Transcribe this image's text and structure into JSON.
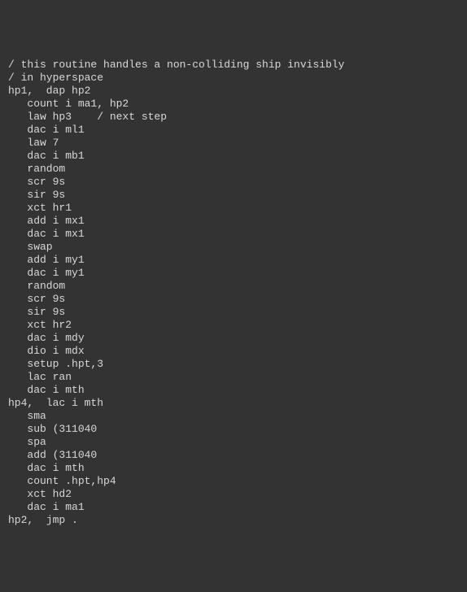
{
  "code": {
    "lines": [
      "/ this routine handles a non-colliding ship invisibly",
      "/ in hyperspace",
      "",
      "hp1,  dap hp2",
      "   count i ma1, hp2",
      "   law hp3    / next step",
      "   dac i ml1",
      "   law 7",
      "   dac i mb1",
      "   random",
      "   scr 9s",
      "   sir 9s",
      "   xct hr1",
      "   add i mx1",
      "   dac i mx1",
      "   swap",
      "   add i my1",
      "   dac i my1",
      "   random",
      "   scr 9s",
      "   sir 9s",
      "   xct hr2",
      "   dac i mdy",
      "   dio i mdx",
      "   setup .hpt,3",
      "   lac ran",
      "   dac i mth",
      "hp4,  lac i mth",
      "   sma",
      "   sub (311040",
      "   spa",
      "   add (311040",
      "   dac i mth",
      "   count .hpt,hp4",
      "   xct hd2",
      "   dac i ma1",
      "hp2,  jmp ."
    ]
  }
}
